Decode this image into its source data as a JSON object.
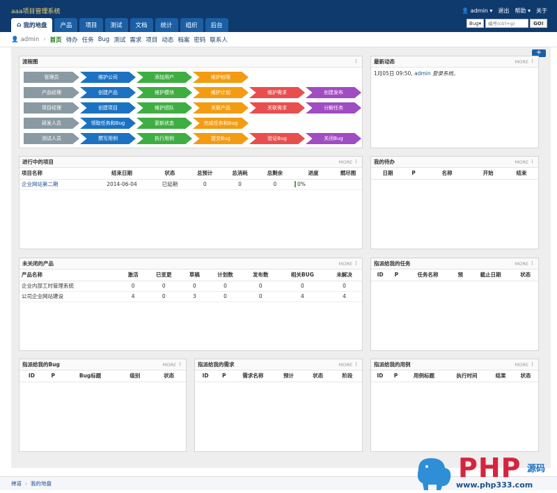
{
  "app": {
    "brand": "aaa项目管理系统"
  },
  "top": {
    "user": "admin",
    "logout": "退出",
    "help": "帮助",
    "about": "关于"
  },
  "main_tabs": [
    {
      "label": "我的地盘",
      "active": true
    },
    {
      "label": "产品"
    },
    {
      "label": "项目"
    },
    {
      "label": "测试"
    },
    {
      "label": "文档"
    },
    {
      "label": "统计"
    },
    {
      "label": "组织"
    },
    {
      "label": "后台"
    }
  ],
  "search": {
    "type": "Bug",
    "placeholder": "编号(ctrl+g)",
    "go": "GO!"
  },
  "subnav": {
    "user": "admin",
    "items": [
      {
        "label": "首页",
        "active": true
      },
      {
        "label": "待办"
      },
      {
        "label": "任务"
      },
      {
        "label": "Bug"
      },
      {
        "label": "测试"
      },
      {
        "label": "需求"
      },
      {
        "label": "项目"
      },
      {
        "label": "动态"
      },
      {
        "label": "档案"
      },
      {
        "label": "密码"
      },
      {
        "label": "联系人"
      }
    ]
  },
  "flow": {
    "title": "流程图",
    "rows": [
      [
        {
          "t": "管理员",
          "c": "gray"
        },
        {
          "t": "维护公司",
          "c": "blue"
        },
        {
          "t": "添加用户",
          "c": "green"
        },
        {
          "t": "维护权限",
          "c": "orange"
        }
      ],
      [
        {
          "t": "产品经理",
          "c": "gray"
        },
        {
          "t": "创建产品",
          "c": "blue"
        },
        {
          "t": "维护模块",
          "c": "green"
        },
        {
          "t": "维护计划",
          "c": "orange"
        },
        {
          "t": "维护需求",
          "c": "red"
        },
        {
          "t": "创建发布",
          "c": "purple"
        }
      ],
      [
        {
          "t": "项目经理",
          "c": "gray"
        },
        {
          "t": "创建项目",
          "c": "blue"
        },
        {
          "t": "维护团队",
          "c": "green"
        },
        {
          "t": "关联产品",
          "c": "orange"
        },
        {
          "t": "关联需求",
          "c": "red"
        },
        {
          "t": "分解任务",
          "c": "purple"
        }
      ],
      [
        {
          "t": "研发人员",
          "c": "gray"
        },
        {
          "t": "领取任务和Bug",
          "c": "blue"
        },
        {
          "t": "更新状态",
          "c": "green"
        },
        {
          "t": "完成任务和Bug",
          "c": "orange"
        }
      ],
      [
        {
          "t": "测试人员",
          "c": "gray"
        },
        {
          "t": "撰写用例",
          "c": "blue"
        },
        {
          "t": "执行用例",
          "c": "green"
        },
        {
          "t": "提交Bug",
          "c": "orange"
        },
        {
          "t": "验证Bug",
          "c": "red"
        },
        {
          "t": "关闭Bug",
          "c": "purple"
        }
      ]
    ]
  },
  "dynamic": {
    "title": "最新动态",
    "more": "MORE",
    "entry_time": "1月05日 09:50,",
    "entry_user": "admin",
    "entry_action": "登录系统。"
  },
  "projects": {
    "title": "进行中的项目",
    "more": "MORE",
    "headers": {
      "name": "项目名称",
      "end": "结束日期",
      "status": "状态",
      "estimate": "总预计",
      "consumed": "总消耗",
      "left": "总剩余",
      "progress": "进度",
      "burn": "燃尽图"
    },
    "rows": [
      {
        "name": "企业网站第二期",
        "end": "2014-06-04",
        "status": "已延期",
        "estimate": "0",
        "consumed": "0",
        "left": "0",
        "progress": "0%"
      }
    ]
  },
  "todo": {
    "title": "我的待办",
    "more": "MORE",
    "headers": {
      "date": "日期",
      "p": "P",
      "name": "名称",
      "start": "开始",
      "end": "结束"
    }
  },
  "products": {
    "title": "未关闭的产品",
    "more": "MORE",
    "headers": {
      "name": "产品名称",
      "active": "激活",
      "changed": "已变更",
      "draft": "草稿",
      "plans": "计划数",
      "releases": "发布数",
      "bugs": "相关BUG",
      "unresolved": "未解决"
    },
    "rows": [
      {
        "name": "企业内部工时管理系统",
        "active": "0",
        "changed": "0",
        "draft": "0",
        "plans": "0",
        "releases": "0",
        "bugs": "0",
        "unresolved": "0"
      },
      {
        "name": "公司企业网站建设",
        "active": "4",
        "changed": "0",
        "draft": "3",
        "plans": "0",
        "releases": "0",
        "bugs": "4",
        "unresolved": "4"
      }
    ]
  },
  "tasks": {
    "title": "指派给我的任务",
    "more": "MORE",
    "headers": {
      "id": "ID",
      "p": "P",
      "name": "任务名称",
      "est": "预",
      "deadline": "截止日期",
      "status": "状态"
    }
  },
  "bugs": {
    "title": "指派给我的Bug",
    "more": "MORE",
    "headers": {
      "id": "ID",
      "p": "P",
      "title": "Bug标题",
      "level": "级别",
      "status": "状态"
    }
  },
  "stories": {
    "title": "指派给我的需求",
    "more": "MORE",
    "headers": {
      "id": "ID",
      "p": "P",
      "name": "需求名称",
      "est": "预计",
      "status": "状态",
      "stage": "阶段"
    }
  },
  "cases": {
    "title": "指派给我的用例",
    "more": "MORE",
    "headers": {
      "id": "ID",
      "p": "P",
      "title": "用例标题",
      "time": "执行时间",
      "result": "结果",
      "status": "状态"
    }
  },
  "footer": {
    "home": "禅道",
    "current": "我的地盘"
  },
  "watermark": {
    "php": "PHP",
    "code": "源码",
    "url": "www.php333.com"
  }
}
